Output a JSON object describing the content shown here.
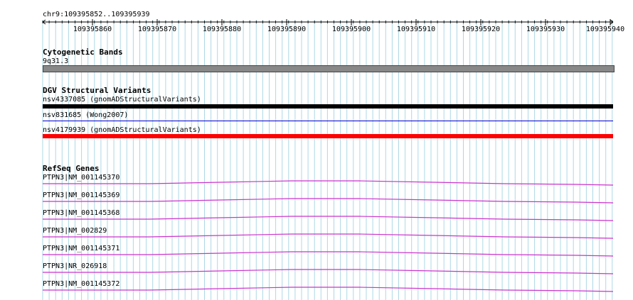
{
  "ruler": {
    "location": "chr9:109395852..109395939",
    "ticks": [
      "109395860",
      "109395870",
      "109395880",
      "109395890",
      "109395900",
      "109395910",
      "109395920",
      "109395930",
      "109395940"
    ]
  },
  "cytoband": {
    "title": "Cytogenetic Bands",
    "band": "9q31.3",
    "color": "#888888"
  },
  "dgv": {
    "title": "DGV Structural Variants",
    "items": [
      {
        "label": "nsv4337085 (gnomADStructuralVariants)",
        "color": "#000000",
        "style": "thick"
      },
      {
        "label": "nsv831685 (Wong2007)",
        "color": "#0000cc",
        "style": "thin"
      },
      {
        "label": "nsv4179939 (gnomADStructuralVariants)",
        "color": "#ff0000",
        "style": "thick"
      }
    ]
  },
  "refseq": {
    "title": "RefSeq Genes",
    "line_color": "#cc33cc",
    "items": [
      {
        "label": "PTPN3|NM_001145370"
      },
      {
        "label": "PTPN3|NM_001145369"
      },
      {
        "label": "PTPN3|NM_001145368"
      },
      {
        "label": "PTPN3|NM_002829"
      },
      {
        "label": "PTPN3|NM_001145371"
      },
      {
        "label": "PTPN3|NR_026918"
      },
      {
        "label": "PTPN3|NM_001145372"
      }
    ]
  },
  "colors": {
    "grid": "#add8e6",
    "ruler": "#000000"
  }
}
